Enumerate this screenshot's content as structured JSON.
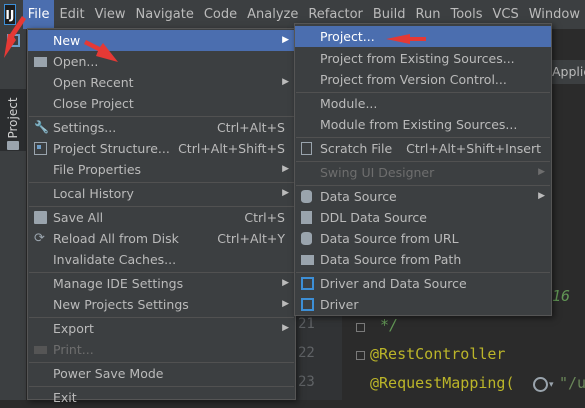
{
  "app_logo": "IJ",
  "menubar": [
    "File",
    "Edit",
    "View",
    "Navigate",
    "Code",
    "Analyze",
    "Refactor",
    "Build",
    "Run",
    "Tools",
    "VCS",
    "Window"
  ],
  "left_strip": {
    "project_tab": "Project"
  },
  "editor_tab": "Applic",
  "file_menu": {
    "new": "New",
    "open": "Open...",
    "open_recent": "Open Recent",
    "close_project": "Close Project",
    "settings": "Settings...",
    "settings_sc": "Ctrl+Alt+S",
    "project_structure": "Project Structure...",
    "project_structure_sc": "Ctrl+Alt+Shift+S",
    "file_properties": "File Properties",
    "local_history": "Local History",
    "save_all": "Save All",
    "save_all_sc": "Ctrl+S",
    "reload": "Reload All from Disk",
    "reload_sc": "Ctrl+Alt+Y",
    "invalidate": "Invalidate Caches...",
    "manage_ide": "Manage IDE Settings",
    "new_projects_settings": "New Projects Settings",
    "export": "Export",
    "print": "Print...",
    "power_save": "Power Save Mode",
    "exit": "Exit"
  },
  "new_menu": {
    "project": "Project...",
    "from_sources": "Project from Existing Sources...",
    "from_vcs": "Project from Version Control...",
    "module": "Module...",
    "module_sources": "Module from Existing Sources...",
    "scratch": "Scratch File",
    "scratch_sc": "Ctrl+Alt+Shift+Insert",
    "swing": "Swing UI Designer",
    "data_source": "Data Source",
    "ddl": "DDL Data Source",
    "ds_url": "Data Source from URL",
    "ds_path": "Data Source from Path",
    "driver_ds": "Driver and Data Source",
    "driver": "Driver"
  },
  "code": {
    "ln_21": "21",
    "ln_22": "22",
    "ln_23": "23",
    "line_16": "16",
    "line_21": "*/",
    "line_22": "@RestController",
    "line_23a": "@RequestMapping(",
    "line_23b": "\"/u"
  },
  "colors": {
    "accent": "#4b6eaf",
    "annotation": "#e53935",
    "annotation_color": "#bbb529"
  }
}
